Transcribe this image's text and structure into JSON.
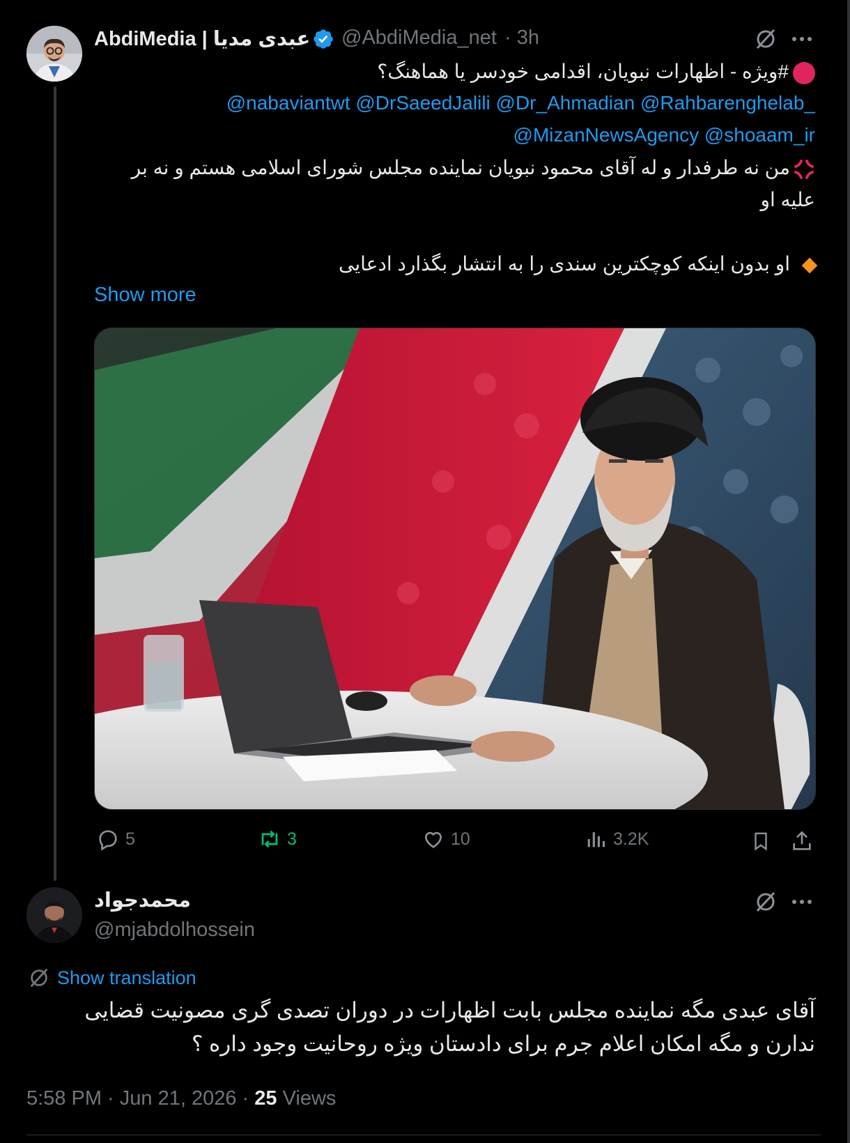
{
  "tweet": {
    "author_name": "AbdiMedia | عبدی مدیا",
    "handle": "@AbdiMedia_net",
    "time": "· 3h",
    "line1": "#ویژه - اظهارات نبویان، اقدامی خودسر یا هماهنگ؟",
    "mentions1": "@nabaviantwt @DrSaeedJalili @Dr_Ahmadian @Rahbarenghelab_",
    "mentions2": "@MizanNewsAgency @shoaam_ir",
    "body1": "من نه طرفدار و له آقای محمود نبویان نماینده مجلس شورای اسلامی هستم و نه بر",
    "body2": "علیه او",
    "body3": "او بدون اینکه کوچکترین سندی را به انتشار بگذارد ادعایی",
    "show_more": "Show more",
    "stats": {
      "replies": "5",
      "reposts": "3",
      "likes": "10",
      "views": "3.2K"
    }
  },
  "reply": {
    "author_name": "محمدجواد",
    "handle": "@mjabdolhossein",
    "show_translation": "Show translation",
    "text1": "آقای عبدی مگه نماینده مجلس بابت اظهارات در دوران تصدی گری مصونیت قضایی",
    "text2": "ندارن و مگه امکان اعلام جرم برای دادستان ویژه روحانیت وجود داره ؟",
    "timestamp": "5:58 PM · Jun 21, 2026 · ",
    "views_count": "25",
    "views_label": " Views"
  },
  "colors": {
    "accent": "#1d9bf0",
    "repost": "#00ba7c",
    "muted": "#71767b"
  },
  "icons": [
    "grok-icon",
    "more-icon",
    "verified-badge-icon",
    "reply-icon",
    "repost-icon",
    "like-icon",
    "views-icon",
    "bookmark-icon",
    "share-icon",
    "translate-icon"
  ]
}
